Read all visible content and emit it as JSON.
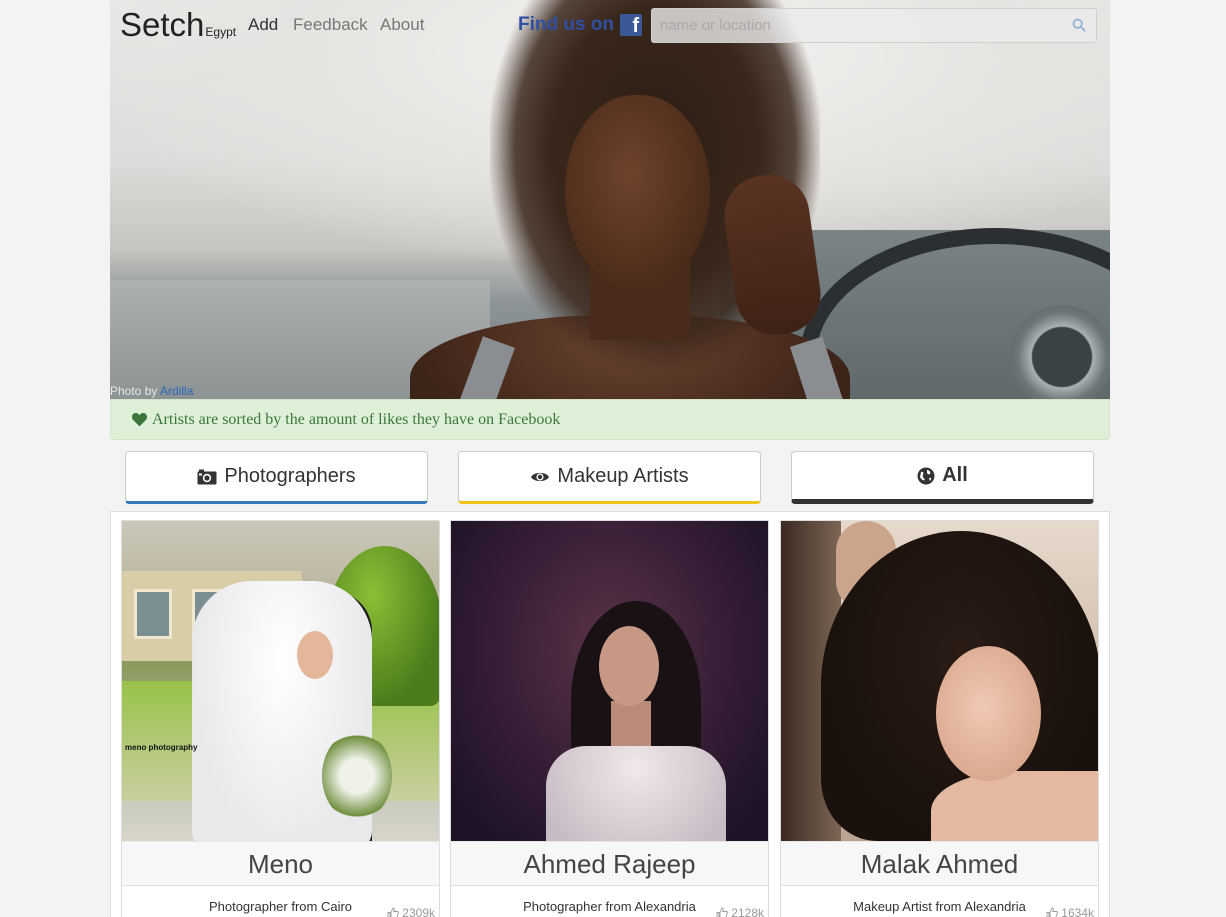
{
  "nav": {
    "brand": "Setch",
    "brand_sub": "Egypt",
    "links": [
      "Add",
      "Feedback",
      "About"
    ],
    "findus": "Find us on",
    "facebook_icon": "facebook-icon",
    "search_placeholder": "name or location",
    "search_icon": "search-icon"
  },
  "hero": {
    "credit_prefix": "Photo by",
    "credit_name": "Ardilla"
  },
  "alert": {
    "icon": "heart-icon",
    "text": "Artists are sorted by the amount of likes they have on Facebook"
  },
  "filters": [
    {
      "label": "Photographers",
      "icon": "camera-icon",
      "accent": "#337ab7"
    },
    {
      "label": "Makeup Artists",
      "icon": "eye-icon",
      "accent": "#f0c419"
    },
    {
      "label": "All",
      "icon": "globe-icon",
      "accent": "#333333"
    }
  ],
  "artists": [
    {
      "name": "Meno",
      "role": "Photographer from Cairo",
      "likes": "2309k"
    },
    {
      "name": "Ahmed Rajeep",
      "role": "Photographer from Alexandria",
      "likes": "2128k"
    },
    {
      "name": "Malak Ahmed",
      "role": "Makeup Artist from Alexandria",
      "likes": "1634k"
    }
  ],
  "colors": {
    "alert_bg": "#dff0d8",
    "alert_text": "#3c763d",
    "brand_blue": "#2f4fa3"
  }
}
